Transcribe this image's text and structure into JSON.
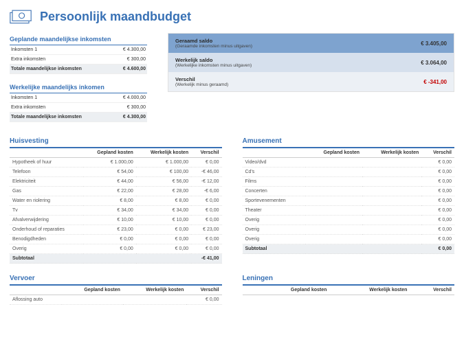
{
  "title": "Persoonlijk maandbudget",
  "planned_income": {
    "header": "Geplande maandelijkse inkomsten",
    "rows": [
      {
        "label": "Inkomsten 1",
        "value": "€ 4.300,00"
      },
      {
        "label": "Extra inkomsten",
        "value": "€ 300,00"
      }
    ],
    "total_label": "Totale maandelijkse inkomsten",
    "total_value": "€ 4.600,00"
  },
  "actual_income": {
    "header": "Werkelijke maandelijks inkomen",
    "rows": [
      {
        "label": "Inkomsten 1",
        "value": "€ 4.000,00"
      },
      {
        "label": "Extra inkomsten",
        "value": "€ 300,00"
      }
    ],
    "total_label": "Totale maandelijkse inkomsten",
    "total_value": "€ 4.300,00"
  },
  "summary": {
    "r1_label": "Geraamd saldo",
    "r1_sub": "(Geraamde inkomsten minus uitgaven)",
    "r1_val": "€ 3.405,00",
    "r2_label": "Werkelijk saldo",
    "r2_sub": "(Werkelijke inkomsten minus uitgaven)",
    "r2_val": "€ 3.064,00",
    "r3_label": "Verschil",
    "r3_sub": "(Werkelijk minus geraamd)",
    "r3_val": "€ -341,00"
  },
  "col_headers": {
    "c1": "Gepland kosten",
    "c2": "Werkelijk kosten",
    "c3": "Verschil"
  },
  "huisvesting": {
    "header": "Huisvesting",
    "rows": [
      {
        "label": "Hypotheek of huur",
        "c1": "€ 1.000,00",
        "c2": "€ 1.000,00",
        "c3": "€ 0,00"
      },
      {
        "label": "Telefoon",
        "c1": "€ 54,00",
        "c2": "€ 100,00",
        "c3": "-€ 46,00"
      },
      {
        "label": "Elektriciteit",
        "c1": "€ 44,00",
        "c2": "€ 56,00",
        "c3": "-€ 12,00"
      },
      {
        "label": "Gas",
        "c1": "€ 22,00",
        "c2": "€ 28,00",
        "c3": "-€ 6,00"
      },
      {
        "label": "Water en riolering",
        "c1": "€ 8,00",
        "c2": "€ 8,00",
        "c3": "€ 0,00"
      },
      {
        "label": "Tv",
        "c1": "€ 34,00",
        "c2": "€ 34,00",
        "c3": "€ 0,00"
      },
      {
        "label": "Afvalverwijdering",
        "c1": "€ 10,00",
        "c2": "€ 10,00",
        "c3": "€ 0,00"
      },
      {
        "label": "Onderhoud of reparaties",
        "c1": "€ 23,00",
        "c2": "€ 0,00",
        "c3": "€ 23,00"
      },
      {
        "label": "Benodigdheden",
        "c1": "€ 0,00",
        "c2": "€ 0,00",
        "c3": "€ 0,00"
      },
      {
        "label": "Overig",
        "c1": "€ 0,00",
        "c2": "€ 0,00",
        "c3": "€ 0,00"
      }
    ],
    "subtotal_label": "Subtotaal",
    "subtotal_diff": "-€ 41,00"
  },
  "amusement": {
    "header": "Amusement",
    "rows": [
      {
        "label": "Video/dvd",
        "c1": "",
        "c2": "",
        "c3": "€ 0,00"
      },
      {
        "label": "Cd's",
        "c1": "",
        "c2": "",
        "c3": "€ 0,00"
      },
      {
        "label": "Films",
        "c1": "",
        "c2": "",
        "c3": "€ 0,00"
      },
      {
        "label": "Concerten",
        "c1": "",
        "c2": "",
        "c3": "€ 0,00"
      },
      {
        "label": "Sportevenementen",
        "c1": "",
        "c2": "",
        "c3": "€ 0,00"
      },
      {
        "label": "Theater",
        "c1": "",
        "c2": "",
        "c3": "€ 0,00"
      },
      {
        "label": "Overig",
        "c1": "",
        "c2": "",
        "c3": "€ 0,00"
      },
      {
        "label": "Overig",
        "c1": "",
        "c2": "",
        "c3": "€ 0,00"
      },
      {
        "label": "Overig",
        "c1": "",
        "c2": "",
        "c3": "€ 0,00"
      }
    ],
    "subtotal_label": "Subtotaal",
    "subtotal_diff": "€ 0,00"
  },
  "vervoer": {
    "header": "Vervoer",
    "rows": [
      {
        "label": "Aflossing auto",
        "c1": "",
        "c2": "",
        "c3": "€ 0,00"
      }
    ]
  },
  "leningen": {
    "header": "Leningen",
    "rows": [
      {
        "label": "",
        "c1": "",
        "c2": "",
        "c3": ""
      }
    ]
  }
}
